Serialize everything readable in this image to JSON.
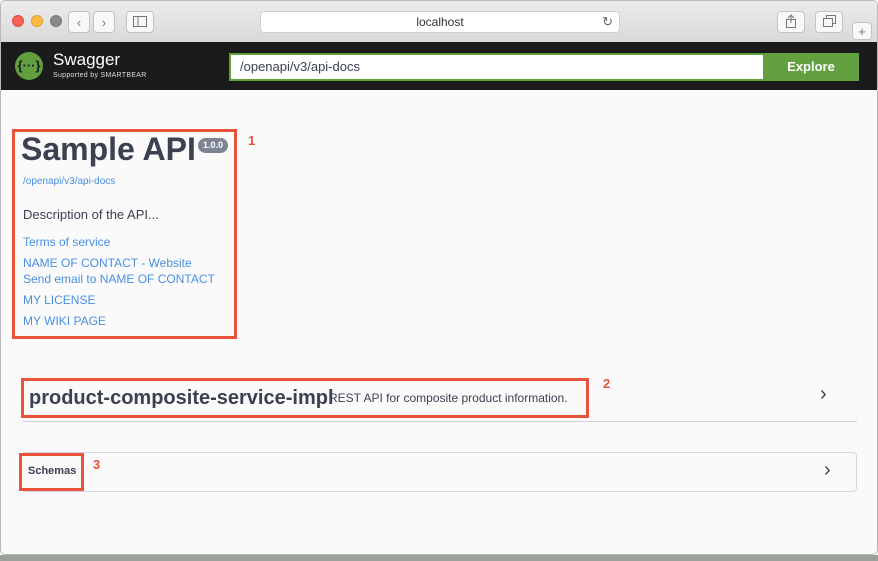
{
  "browser": {
    "url": "localhost",
    "back_icon": "chevron-left",
    "forward_icon": "chevron-right",
    "sidebar_icon": "sidebar",
    "reload_icon": "reload",
    "share_icon": "share",
    "tabs_icon": "tabs",
    "new_tab_icon": "plus"
  },
  "swagger": {
    "logo_glyph": "{···}",
    "logo_title": "Swagger",
    "logo_subtitle": "Supported by SMARTBEAR",
    "explore_value": "/openapi/v3/api-docs",
    "explore_label": "Explore"
  },
  "info": {
    "title": "Sample API",
    "version": "1.0.0",
    "spec_url": "/openapi/v3/api-docs",
    "description": "Description of the API...",
    "terms": "Terms of service",
    "contact_website": "NAME OF CONTACT - Website",
    "contact_email": "Send email to NAME OF CONTACT",
    "license": "MY LICENSE",
    "wiki": "MY WIKI PAGE"
  },
  "tag": {
    "name": "product-composite-service-impl",
    "description": "REST API for composite product information."
  },
  "schemas": {
    "label": "Schemas"
  },
  "annotations": {
    "n1": "1",
    "n2": "2",
    "n3": "3"
  },
  "colors": {
    "accent": "#62a03f",
    "highlight": "#e8513a",
    "link": "#4990e2"
  }
}
